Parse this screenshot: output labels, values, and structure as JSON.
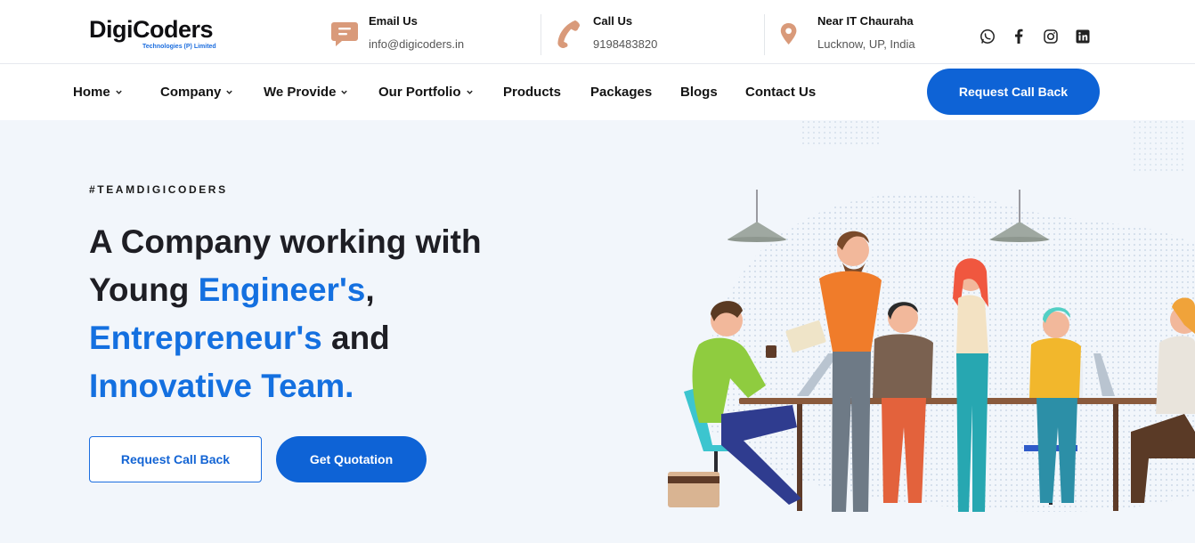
{
  "brand": {
    "name": "DigiCoders",
    "tagline": "Technologies (P) Limited",
    "accent": "#0e63d6"
  },
  "topbar": {
    "email": {
      "title": "Email Us",
      "value": "info@digicoders.in",
      "icon": "message-icon"
    },
    "phone": {
      "title": "Call Us",
      "value": "9198483820",
      "icon": "phone-icon"
    },
    "address": {
      "title": "Near IT Chauraha",
      "value": "Lucknow, UP, India",
      "icon": "location-pin-icon"
    },
    "social": [
      "whatsapp-icon",
      "facebook-icon",
      "instagram-icon",
      "linkedin-icon"
    ]
  },
  "nav": {
    "items": [
      {
        "label": "Home",
        "dropdown": true
      },
      {
        "label": "Company",
        "dropdown": true
      },
      {
        "label": "We Provide",
        "dropdown": true
      },
      {
        "label": "Our Portfolio",
        "dropdown": true
      },
      {
        "label": "Products",
        "dropdown": false
      },
      {
        "label": "Packages",
        "dropdown": false
      },
      {
        "label": "Blogs",
        "dropdown": false
      },
      {
        "label": "Contact Us",
        "dropdown": false
      }
    ],
    "cta": "Request Call Back"
  },
  "hero": {
    "tag": "#TEAMDIGICODERS",
    "line1": "A Company working with",
    "line2_plain": "Young ",
    "line2_blue": "Engineer's",
    "line2_tail": ",",
    "line3_blue": "Entrepreneur's",
    "line3_plain": " and",
    "line4_blue": "Innovative Team.",
    "btn_secondary": "Request Call Back",
    "btn_primary": "Get Quotation"
  }
}
